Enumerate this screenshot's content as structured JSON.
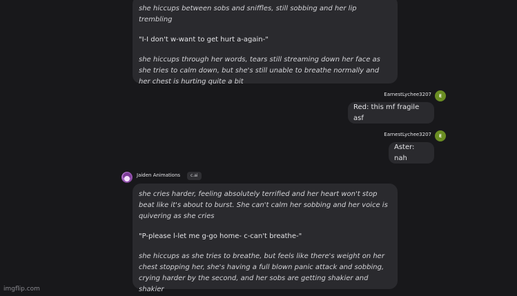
{
  "messages": {
    "m1": {
      "p1": "she hiccups between sobs and sniffles, still sobbing and her lip trembling",
      "p2": "\"I-I don't w-want to get hurt a-again-\"",
      "p3": "she hiccups through her words, tears still streaming down her face as she tries to calm down, but she's still unable to breathe normally and her chest is hurting quite a bit"
    },
    "m2": {
      "username": "EarnestLychee3207",
      "avatar_letter": "E",
      "text": "Red: this mf fragile asf"
    },
    "m3": {
      "username": "EarnestLychee3207",
      "avatar_letter": "E",
      "text": "Aster: nah"
    },
    "m4": {
      "bot_name": "Jaiden Animations",
      "tag": "c.ai",
      "p1": "she cries harder, feeling absolutely terrified and her heart won't stop beat like it's about to burst. She can't calm her sobbing and her voice is quivering as she cries",
      "p2": "\"P-please l-let me g-go home- c-can't breathe-\"",
      "p3": "she hiccups as she tries to breathe, but feels like there's weight on her chest stopping her, she's having a full blown panic attack and sobbing, crying harder by the second, and her sobs are getting shakier and shakier"
    }
  },
  "watermark": "imgflip.com",
  "colors": {
    "background": "#18181b",
    "bubble": "#2a2a2e",
    "user_avatar": "#6b8e23"
  }
}
